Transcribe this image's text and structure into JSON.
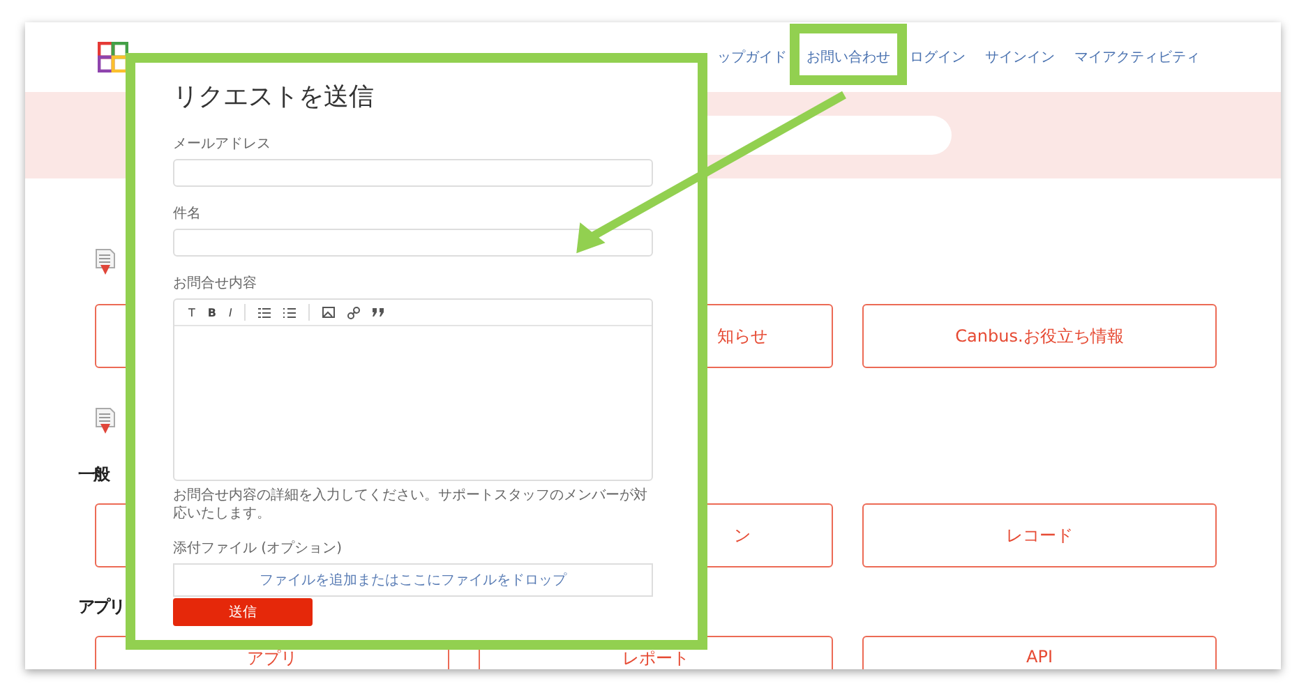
{
  "nav": {
    "items": [
      {
        "label": "ップガイド",
        "highlighted": false
      },
      {
        "label": "お問い合わせ",
        "highlighted": true
      },
      {
        "label": "ログイン",
        "highlighted": false
      },
      {
        "label": "サインイン",
        "highlighted": false
      },
      {
        "label": "マイアクティビティ",
        "highlighted": false
      }
    ]
  },
  "sections": [
    {
      "buttons": [
        {
          "kind": "covered"
        },
        {
          "kind": "labeled",
          "label": "知らせ"
        },
        {
          "kind": "labeled",
          "label": "Canbus.お役立ち情報"
        }
      ]
    },
    {
      "heading": "一般",
      "buttons": [
        {
          "kind": "covered"
        },
        {
          "kind": "labeled",
          "label": "ン"
        },
        {
          "kind": "labeled",
          "label": "レコード"
        }
      ]
    },
    {
      "heading": "アプリ",
      "buttons": [
        {
          "kind": "labeled",
          "label": "アプリ"
        },
        {
          "kind": "labeled",
          "label": "レポート"
        },
        {
          "kind": "labeled",
          "label": "API"
        }
      ]
    }
  ],
  "request_form": {
    "title": "リクエストを送信",
    "email": {
      "label": "メールアドレス"
    },
    "subject": {
      "label": "件名"
    },
    "message": {
      "label": "お問合せ内容",
      "hint": "お問合せ内容の詳細を入力してください。サポートスタッフのメンバーが対応いたします。",
      "toolbar": [
        {
          "kind": "text",
          "label": "T"
        },
        {
          "kind": "bold",
          "label": "B"
        },
        {
          "kind": "italic",
          "label": "I"
        },
        {
          "kind": "separator"
        },
        {
          "kind": "bullet-list"
        },
        {
          "kind": "numbered-list"
        },
        {
          "kind": "separator"
        },
        {
          "kind": "image"
        },
        {
          "kind": "link"
        },
        {
          "kind": "quote"
        }
      ]
    },
    "attachment": {
      "label": "添付ファイル (オプション)",
      "drop_text": "ファイルを追加またはここにファイルをドロップ"
    },
    "submit": "送信"
  }
}
